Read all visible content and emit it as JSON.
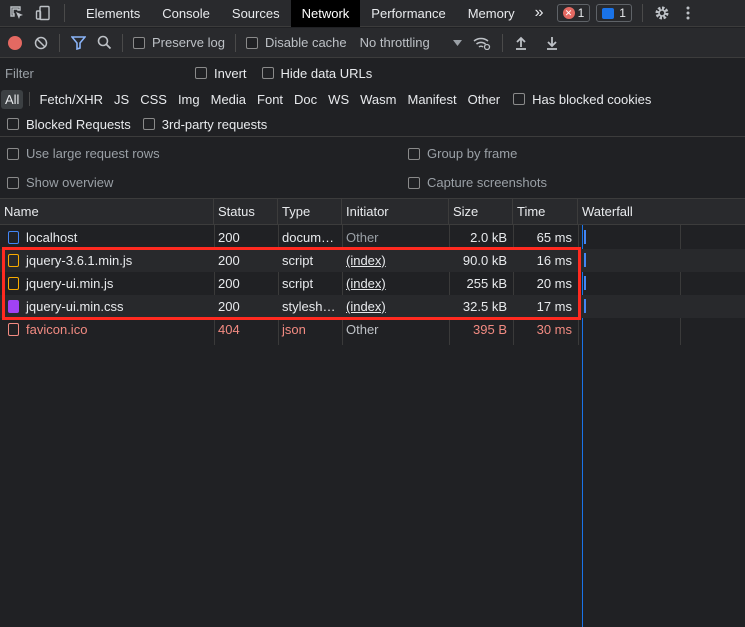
{
  "tabs": {
    "items": [
      "Elements",
      "Console",
      "Sources",
      "Network",
      "Performance",
      "Memory"
    ],
    "active": "Network",
    "more": "»",
    "errors_count": "1",
    "messages_count": "1"
  },
  "toolbar": {
    "preserve_log": "Preserve log",
    "disable_cache": "Disable cache",
    "throttling": "No throttling"
  },
  "filter": {
    "placeholder": "Filter",
    "invert": "Invert",
    "hide_data_urls": "Hide data URLs"
  },
  "types": {
    "items": [
      "All",
      "Fetch/XHR",
      "JS",
      "CSS",
      "Img",
      "Media",
      "Font",
      "Doc",
      "WS",
      "Wasm",
      "Manifest",
      "Other"
    ],
    "active": "All",
    "has_blocked_cookies": "Has blocked cookies"
  },
  "blocked": {
    "blocked_requests": "Blocked Requests",
    "third_party": "3rd-party requests"
  },
  "settings": {
    "large_rows": "Use large request rows",
    "group_by_frame": "Group by frame",
    "show_overview": "Show overview",
    "capture_screenshots": "Capture screenshots"
  },
  "table": {
    "columns": [
      "Name",
      "Status",
      "Type",
      "Initiator",
      "Size",
      "Time",
      "Waterfall"
    ],
    "rows": [
      {
        "name": "localhost",
        "status": "200",
        "type": "docum…",
        "initiator": "Other",
        "size": "2.0 kB",
        "time": "65 ms",
        "icon": "document-icon"
      },
      {
        "name": "jquery-3.6.1.min.js",
        "status": "200",
        "type": "script",
        "initiator": "(index)",
        "size": "90.0 kB",
        "time": "16 ms",
        "icon": "script-icon"
      },
      {
        "name": "jquery-ui.min.js",
        "status": "200",
        "type": "script",
        "initiator": "(index)",
        "size": "255 kB",
        "time": "20 ms",
        "icon": "script-icon"
      },
      {
        "name": "jquery-ui.min.css",
        "status": "200",
        "type": "stylesh…",
        "initiator": "(index)",
        "size": "32.5 kB",
        "time": "17 ms",
        "icon": "stylesheet-icon"
      },
      {
        "name": "favicon.ico",
        "status": "404",
        "type": "json",
        "initiator": "Other",
        "size": "395 B",
        "time": "30 ms",
        "icon": "error-file-icon"
      }
    ]
  },
  "colors": {
    "error_text": "#f28b82",
    "highlight": "#ff2a20",
    "waterfall": "#1a73e8",
    "document": "#4285f4",
    "script": "#f9ab00",
    "stylesheet": "#a142f4"
  }
}
